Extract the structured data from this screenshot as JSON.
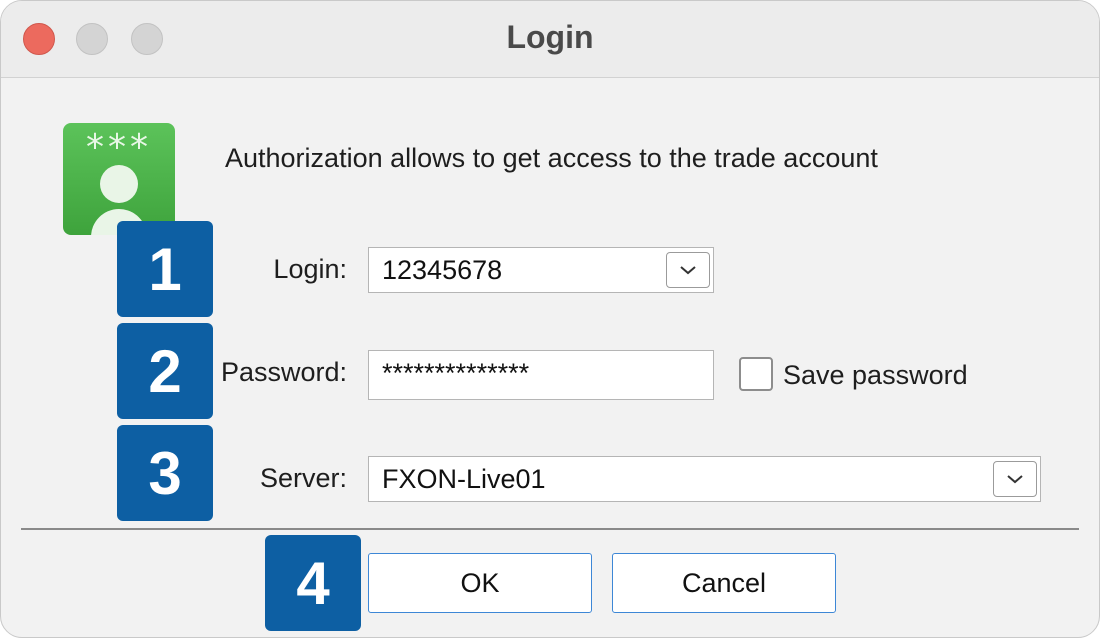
{
  "window": {
    "title": "Login"
  },
  "header": {
    "description": "Authorization allows to get access to the trade account",
    "icon": "login-credentials-icon",
    "icon_stars": "***"
  },
  "badges": [
    "1",
    "2",
    "3",
    "4"
  ],
  "form": {
    "login": {
      "label": "Login:",
      "value": "12345678"
    },
    "password": {
      "label": "Password:",
      "value": "**************"
    },
    "save_password": {
      "label": "Save password",
      "checked": false
    },
    "server": {
      "label": "Server:",
      "value": "FXON-Live01"
    }
  },
  "buttons": {
    "ok": "OK",
    "cancel": "Cancel"
  },
  "colors": {
    "badge": "#0d5fa3",
    "close": "#ec6a5e",
    "button_border": "#3d87d6"
  }
}
